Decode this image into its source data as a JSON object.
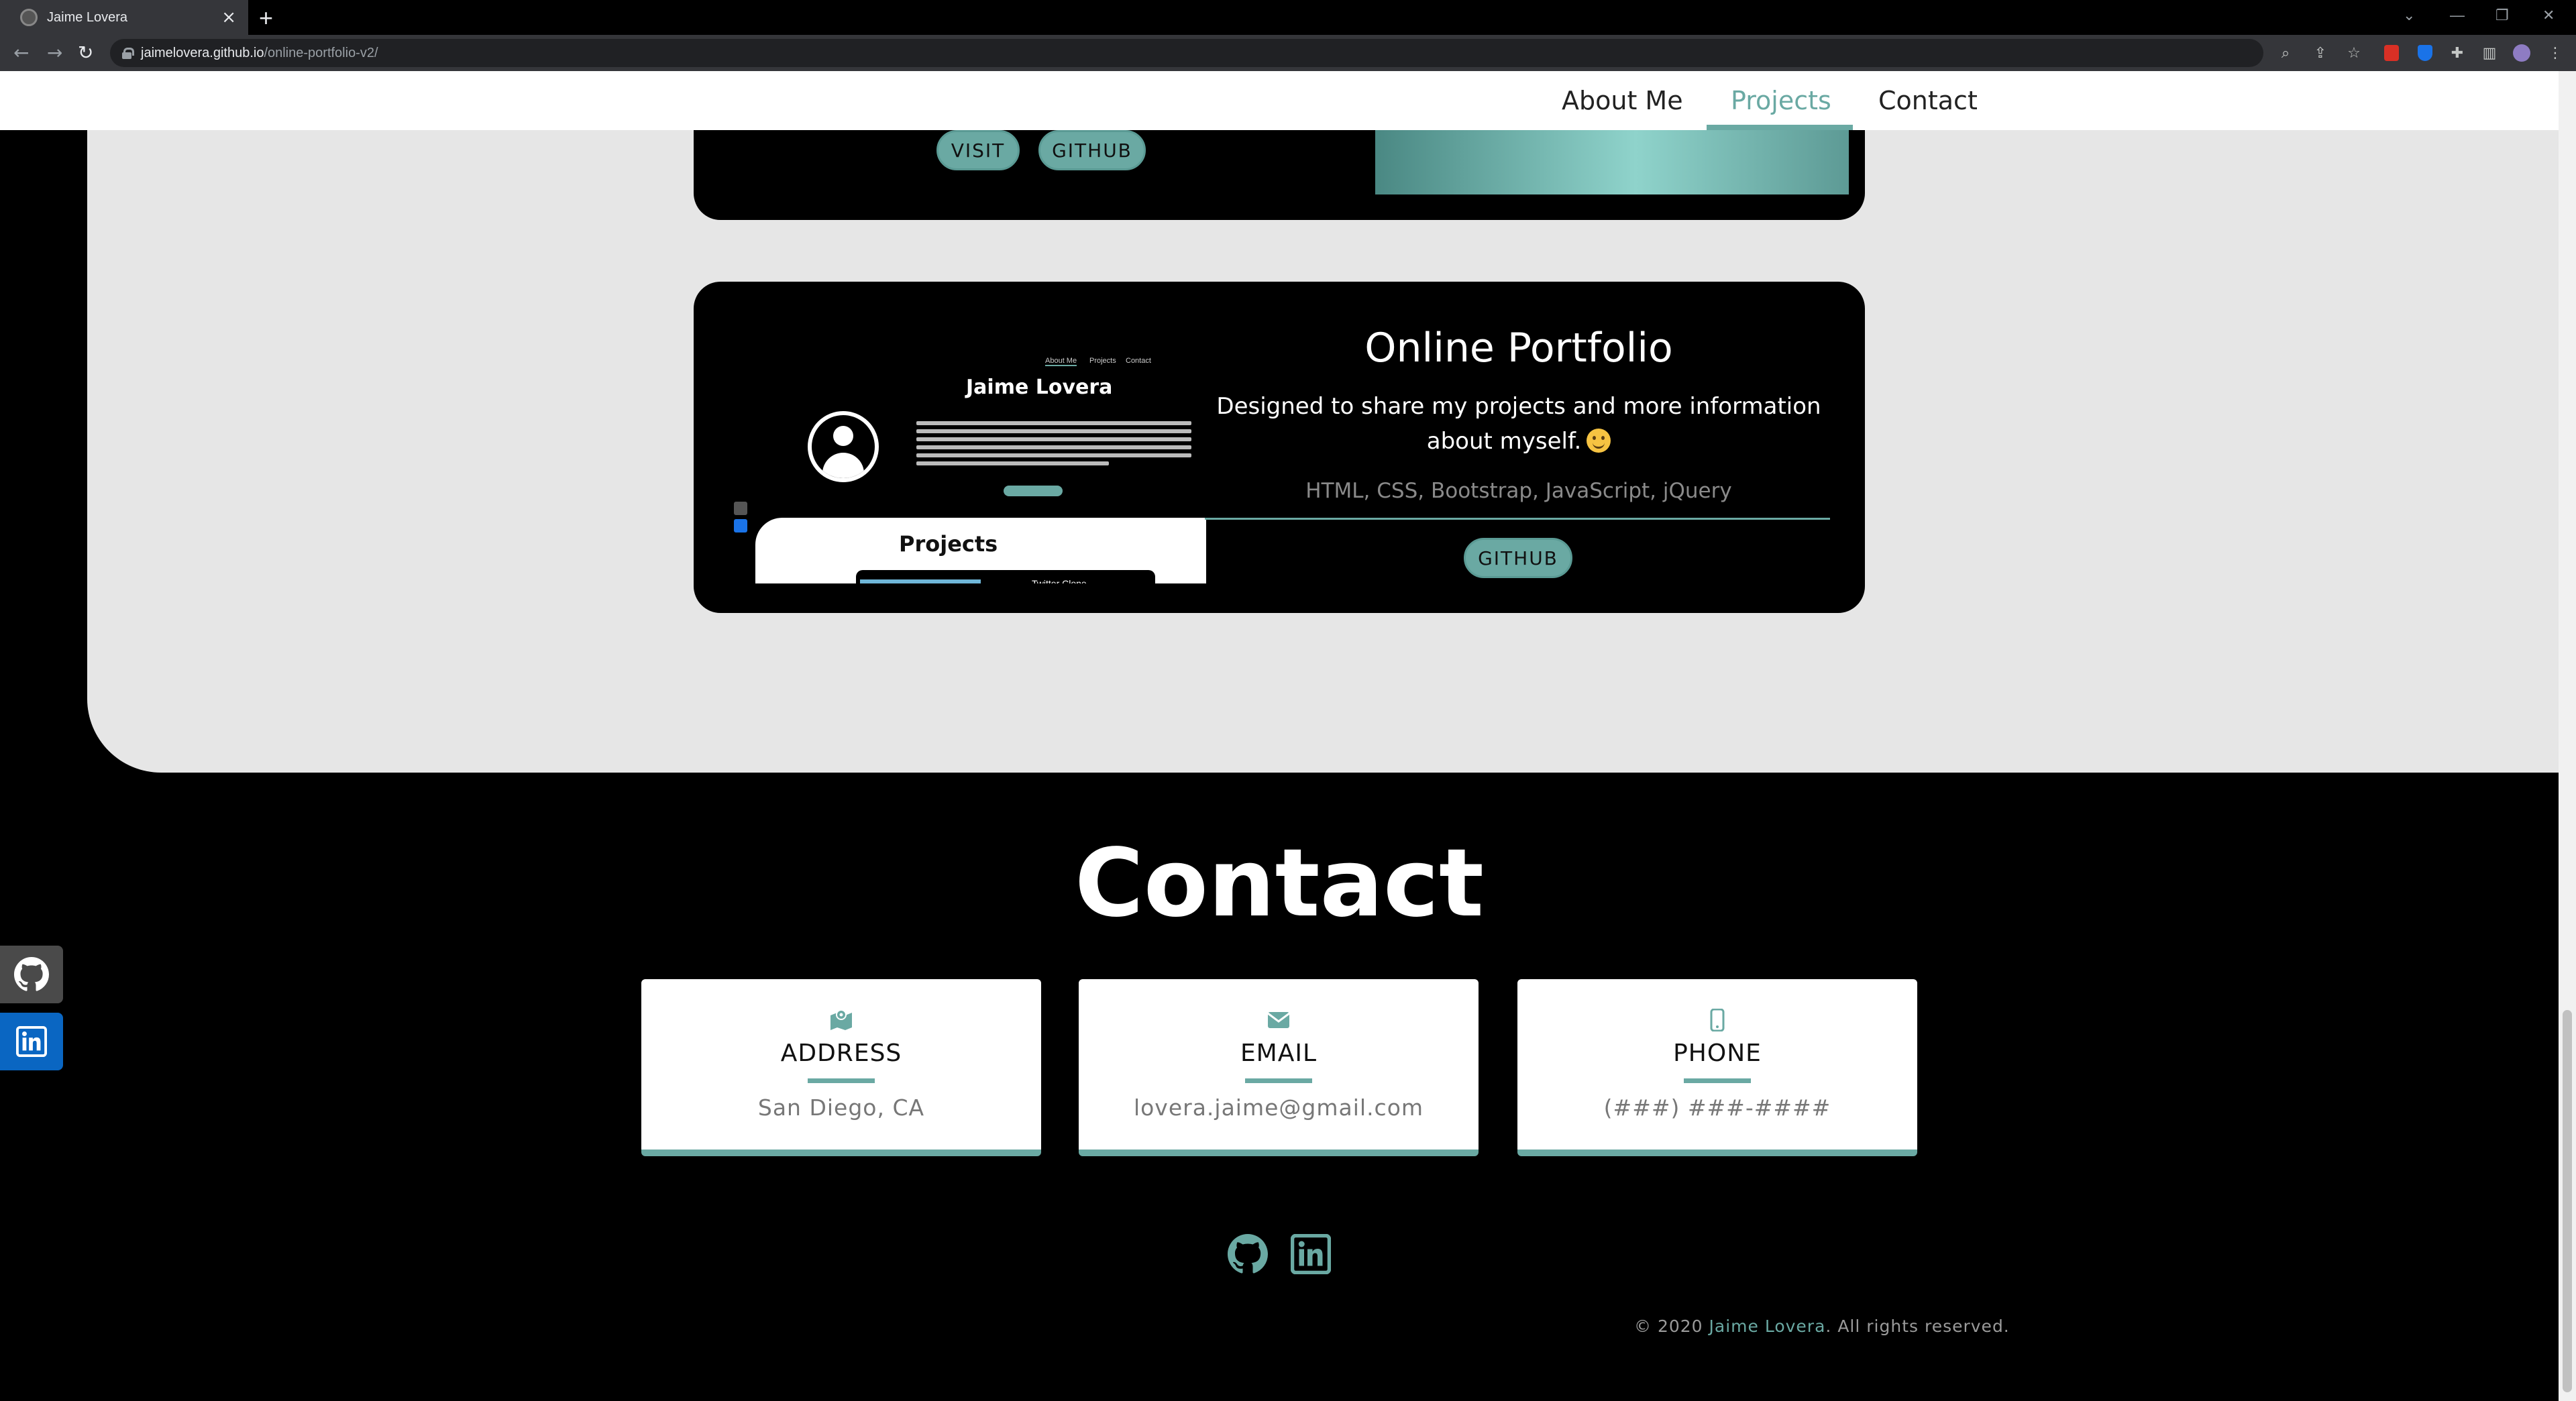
{
  "browser": {
    "tab_title": "Jaime Lovera",
    "tab_close": "×",
    "new_tab": "+",
    "url_host": "jaimelovera.github.io",
    "url_path": "/online-portfolio-v2/",
    "back": "←",
    "forward": "→",
    "reload": "↻"
  },
  "nav": {
    "items": [
      {
        "label": "About Me"
      },
      {
        "label": "Projects"
      },
      {
        "label": "Contact"
      }
    ],
    "active": "Projects"
  },
  "projects": {
    "previous_card": {
      "visit_label": "VISIT",
      "github_label": "GITHUB"
    },
    "card": {
      "title": "Online Portfolio",
      "description": "Designed to share my projects and more information about myself.",
      "tech": "HTML, CSS, Bootstrap, JavaScript, jQuery",
      "github_label": "GITHUB",
      "screenshot": {
        "nav_items": [
          "About Me",
          "Projects",
          "Contact"
        ],
        "name": "Jaime Lovera",
        "panel_title": "Projects",
        "card_title": "Twitter Clone"
      }
    }
  },
  "contact": {
    "title": "Contact",
    "cards": [
      {
        "icon": "map-icon",
        "label": "ADDRESS",
        "value": "San Diego, CA"
      },
      {
        "icon": "envelope-icon",
        "label": "EMAIL",
        "value": "lovera.jaime@gmail.com"
      },
      {
        "icon": "mobile-icon",
        "label": "PHONE",
        "value": "(###) ###-####"
      }
    ]
  },
  "footer": {
    "copyright_prefix": "© 2020 ",
    "copyright_name": "Jaime Lovera",
    "copyright_suffix": ". All rights reserved."
  },
  "colors": {
    "accent": "#6aa9a3",
    "linkedin": "#0a66c2",
    "github_tab": "#4a4a4a"
  }
}
